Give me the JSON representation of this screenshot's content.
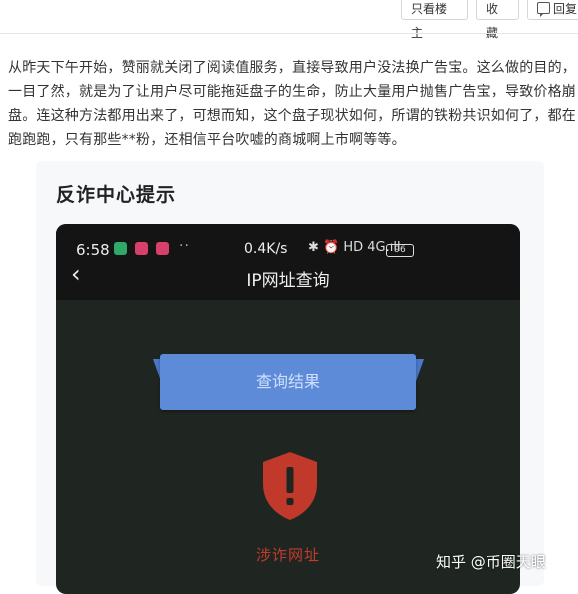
{
  "toolbar": {
    "only_op_label": "只看楼主",
    "favorite_label": "收藏",
    "reply_label": "回复"
  },
  "post": {
    "lines": [
      "从昨天下午开始，赞丽就关闭了阅读值服务，直接导致用户没法换广告宝。这么做的目的，",
      "一目了然，就是为了让用户尽可能拖延盘子的生命，防止大量用户抛售广告宝，导致价格崩",
      "盘。连这种方法都用出来了，可想而知，这个盘子现状如何，所谓的铁粉共识如何了，都在",
      "跑跑跑，只有那些**粉，还相信平台吹嘘的商城啊上市啊等等。"
    ]
  },
  "embedded": {
    "card_title": "反诈中心提示",
    "status": {
      "time": "6:58",
      "dots": "··",
      "speed": "0.4K/s",
      "icons": "✱ ⏰ HD 4G.ıll",
      "battery": "96"
    },
    "nav_title": "IP网址查询",
    "result_button": "查询结果",
    "fraud_label": "涉诈网址",
    "colors": {
      "shield": "#c0392b",
      "button": "#5d8bd8"
    }
  },
  "watermark": "知乎 @币圈天眼"
}
